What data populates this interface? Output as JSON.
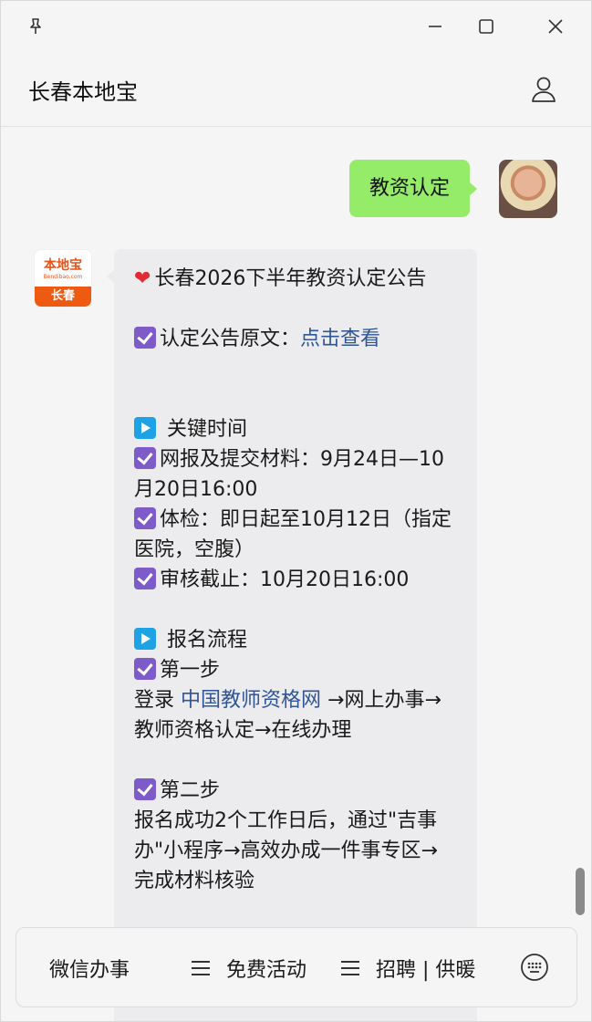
{
  "header": {
    "title": "长春本地宝"
  },
  "chat": {
    "user_message": "教资认定",
    "bot_avatar": {
      "logo_text": "本地宝",
      "logo_url": "Bendibao.com",
      "city": "长春"
    },
    "bot_message": {
      "title": "长春2026下半年教资认定公告",
      "notice_prefix": "认定公告原文：",
      "notice_link": "点击查看",
      "section1_title": "关键时间",
      "t1": "网报及提交材料：9月24日—10月20日16:00",
      "t2": "体检：即日起至10月12日（指定医院，空腹）",
      "t3": "审核截止：10月20日16:00",
      "section2_title": "报名流程",
      "step1_title": "第一步",
      "step1_prefix": "登录 ",
      "step1_link": "中国教师资格网",
      "step1_suffix": " →网上办事→教师资格认定→在线办理",
      "step2_title": "第二步",
      "step2_text": "报名成功2个工作日后，通过\"吉事办\"小程序→高效办成一件事专区→完成材料核验"
    }
  },
  "menu": {
    "item1": "微信办事",
    "item2": "免费活动",
    "item3": "招聘 | 供暖"
  },
  "icons": {
    "pin": "pin-icon",
    "minimize": "minimize-icon",
    "maximize": "maximize-icon",
    "close": "close-icon",
    "profile": "person-icon",
    "keyboard": "keyboard-icon"
  }
}
